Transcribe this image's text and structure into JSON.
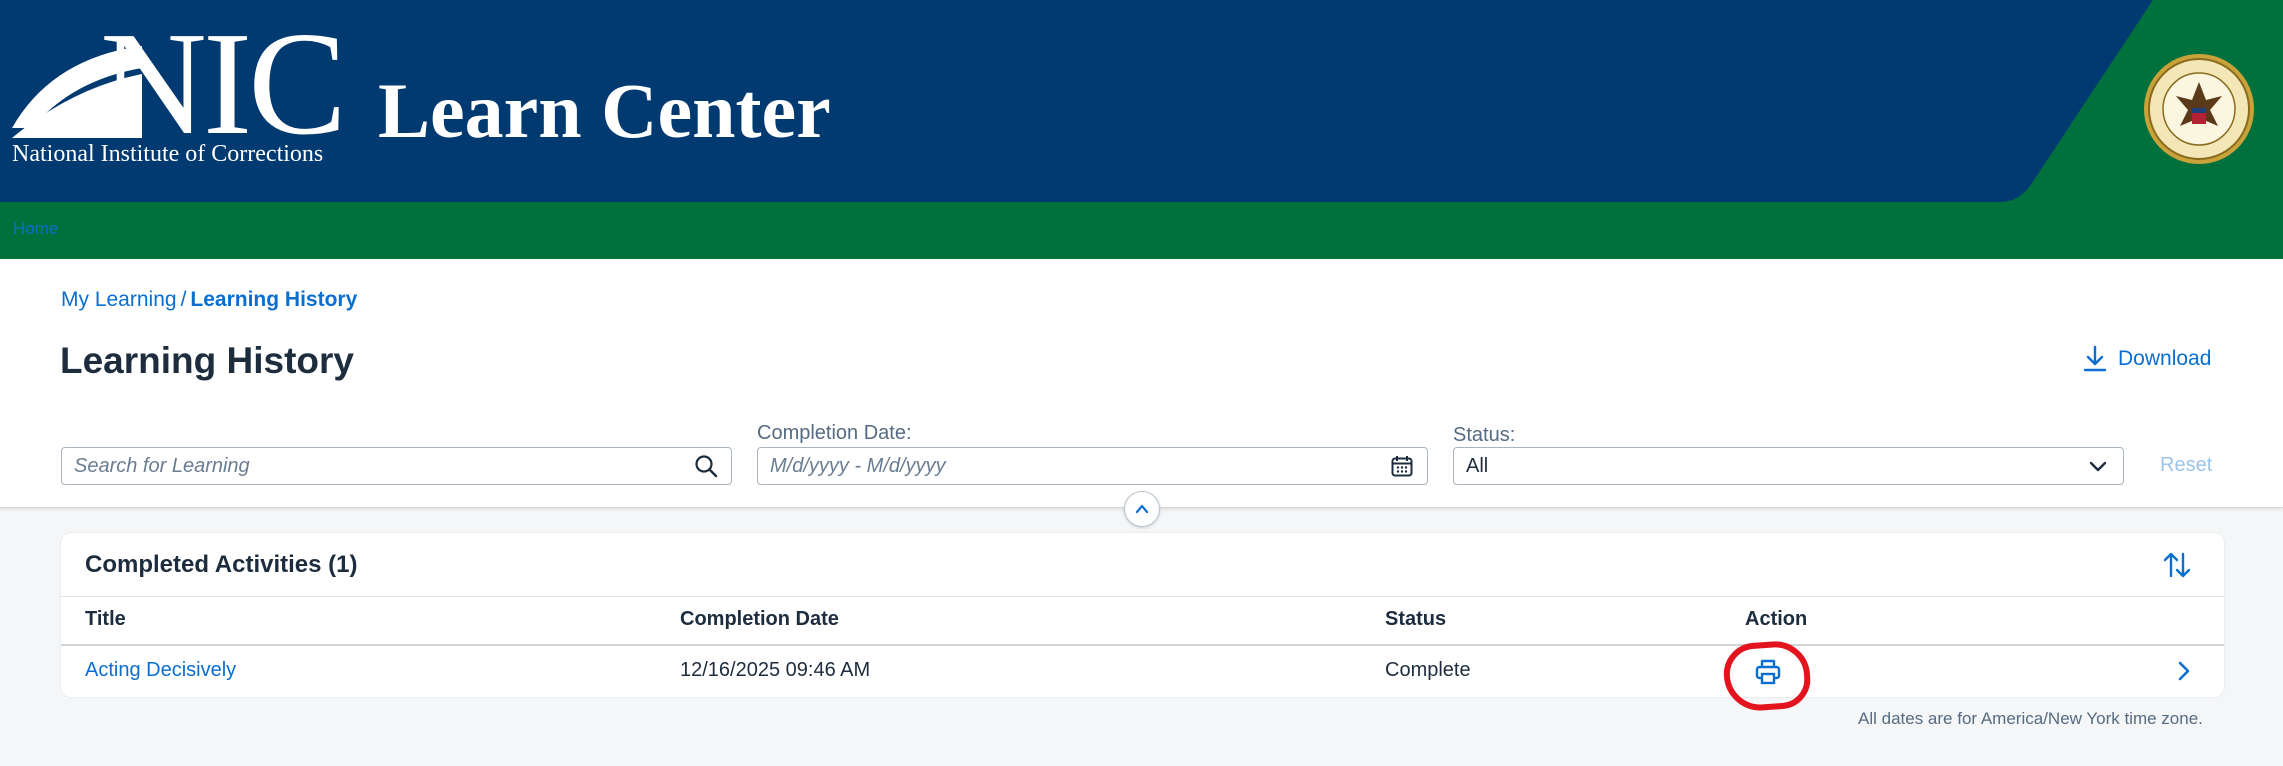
{
  "header": {
    "logo_mark": "NIC",
    "logo_subtitle": "National Institute of Corrections",
    "app_title": "Learn Center",
    "seal_name": "doj-seal",
    "colors": {
      "blue": "#003a70",
      "green": "#00703c"
    }
  },
  "nav": {
    "home": "Home"
  },
  "breadcrumb": {
    "parent": "My Learning",
    "separator": "/",
    "current": "Learning History"
  },
  "page": {
    "title": "Learning History",
    "download_label": "Download"
  },
  "filters": {
    "search_placeholder": "Search for Learning",
    "completion_date_label": "Completion Date:",
    "completion_date_placeholder": "M/d/yyyy - M/d/yyyy",
    "status_label": "Status:",
    "status_value": "All",
    "reset_label": "Reset"
  },
  "activities": {
    "title": "Completed Activities (1)",
    "columns": [
      "Title",
      "Completion Date",
      "Status",
      "Action"
    ],
    "rows": [
      {
        "title": "Acting Decisively",
        "completion_date": "12/16/2025 09:46 AM",
        "status": "Complete",
        "action_icon": "print-icon"
      }
    ],
    "timezone_note": "All dates are for America/New York time zone."
  },
  "colors": {
    "link": "#0a6ed1",
    "highlight": "#e3141e",
    "reset_disabled": "#9cc3ea"
  }
}
